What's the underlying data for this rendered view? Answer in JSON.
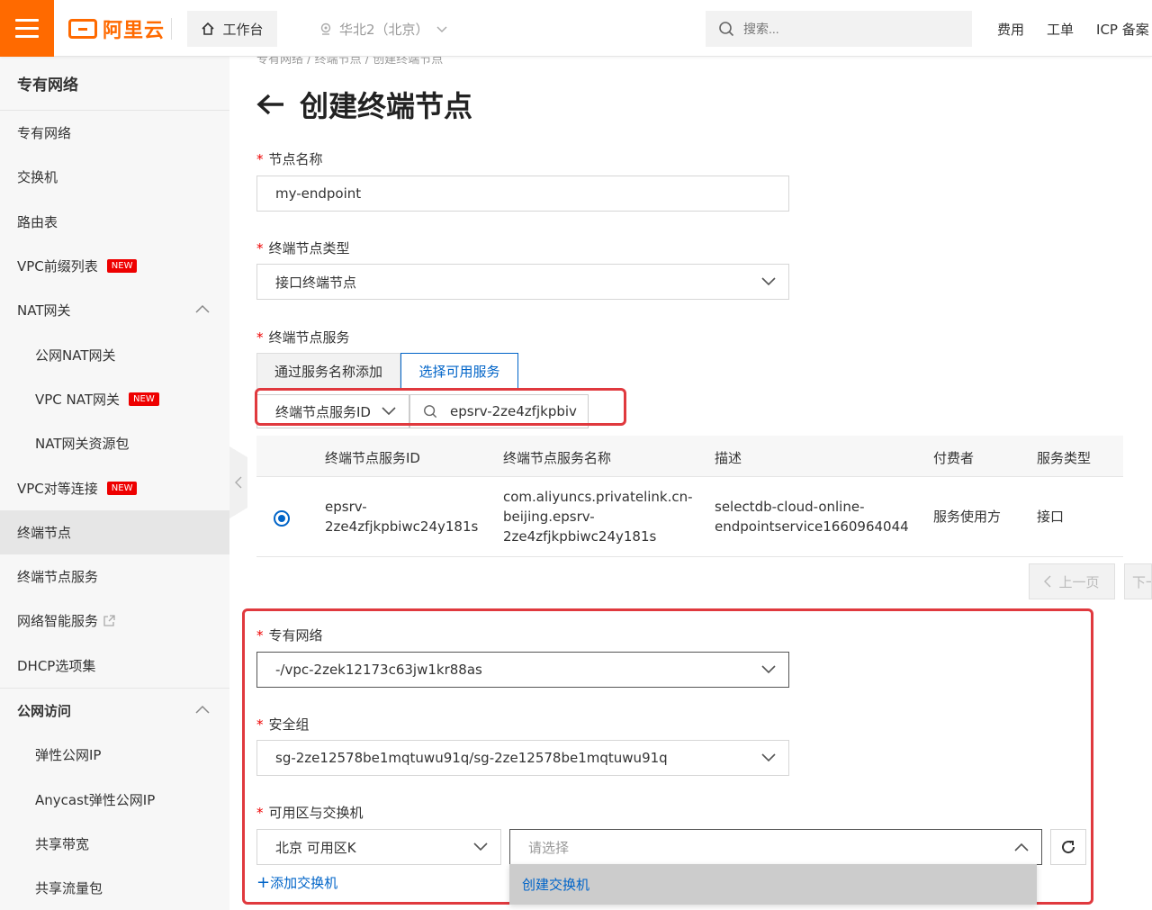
{
  "topbar": {
    "brand": "阿里云",
    "home_label": "工作台",
    "region_label": "华北2（北京）",
    "search_placeholder": "搜索...",
    "links": [
      "费用",
      "工单",
      "ICP 备案"
    ],
    "brand_color": "#ff6a00"
  },
  "sidebar": {
    "title": "专有网络",
    "items": [
      {
        "label": "专有网络"
      },
      {
        "label": "交换机"
      },
      {
        "label": "路由表"
      },
      {
        "label": "VPC前缀列表",
        "badge": "NEW"
      },
      {
        "label": "NAT网关",
        "expanded": true
      },
      {
        "label": "公网NAT网关"
      },
      {
        "label": "VPC NAT网关",
        "badge": "NEW"
      },
      {
        "label": "NAT网关资源包"
      },
      {
        "label": "VPC对等连接",
        "badge": "NEW"
      },
      {
        "label": "终端节点",
        "active": true
      },
      {
        "label": "终端节点服务"
      },
      {
        "label": "网络智能服务"
      },
      {
        "label": "DHCP选项集"
      },
      {
        "label": "公网访问",
        "expanded": true
      },
      {
        "label": "弹性公网IP"
      },
      {
        "label": "Anycast弹性公网IP"
      },
      {
        "label": "共享带宽"
      },
      {
        "label": "共享流量包"
      }
    ]
  },
  "page": {
    "breadcrumb": "专有网络 / 终端节点 / 创建终端节点",
    "title": "创建终端节点"
  },
  "form": {
    "name_label": "节点名称",
    "name_value": "my-endpoint",
    "type_label": "终端节点类型",
    "type_value": "接口终端节点",
    "service_label": "终端节点服务",
    "tab_by_name": "通过服务名称添加",
    "tab_select": "选择可用服务",
    "filter_field": "终端节点服务ID",
    "filter_value": "epsrv-2ze4zfjkpbiv",
    "vpc_label": "专有网络",
    "vpc_value": "-/vpc-2zek12173c63jw1kr88as",
    "sg_label": "安全组",
    "sg_value": "sg-2ze12578be1mqtuwu91q/sg-2ze12578be1mqtuwu91q",
    "zone_label": "可用区与交换机",
    "zone_value": "北京 可用区K",
    "vswitch_placeholder": "请选择",
    "vswitch_option": "创建交换机",
    "add_vswitch": "添加交换机"
  },
  "table": {
    "headers": [
      "终端节点服务ID",
      "终端节点服务名称",
      "描述",
      "付费者",
      "服务类型"
    ],
    "row": {
      "id_line1": "epsrv-",
      "id_line2": "2ze4zfjkpbiwc24y181s",
      "name_line1": "com.aliyuncs.privatelink.cn-",
      "name_line2": "beijing.epsrv-",
      "name_line3": "2ze4zfjkpbiwc24y181s",
      "desc_line1": "selectdb-cloud-online-",
      "desc_line2": "endpointservice1660964044",
      "payer": "服务使用方",
      "type": "接口"
    },
    "prev_label": "上一页",
    "next_label": "下一页"
  }
}
